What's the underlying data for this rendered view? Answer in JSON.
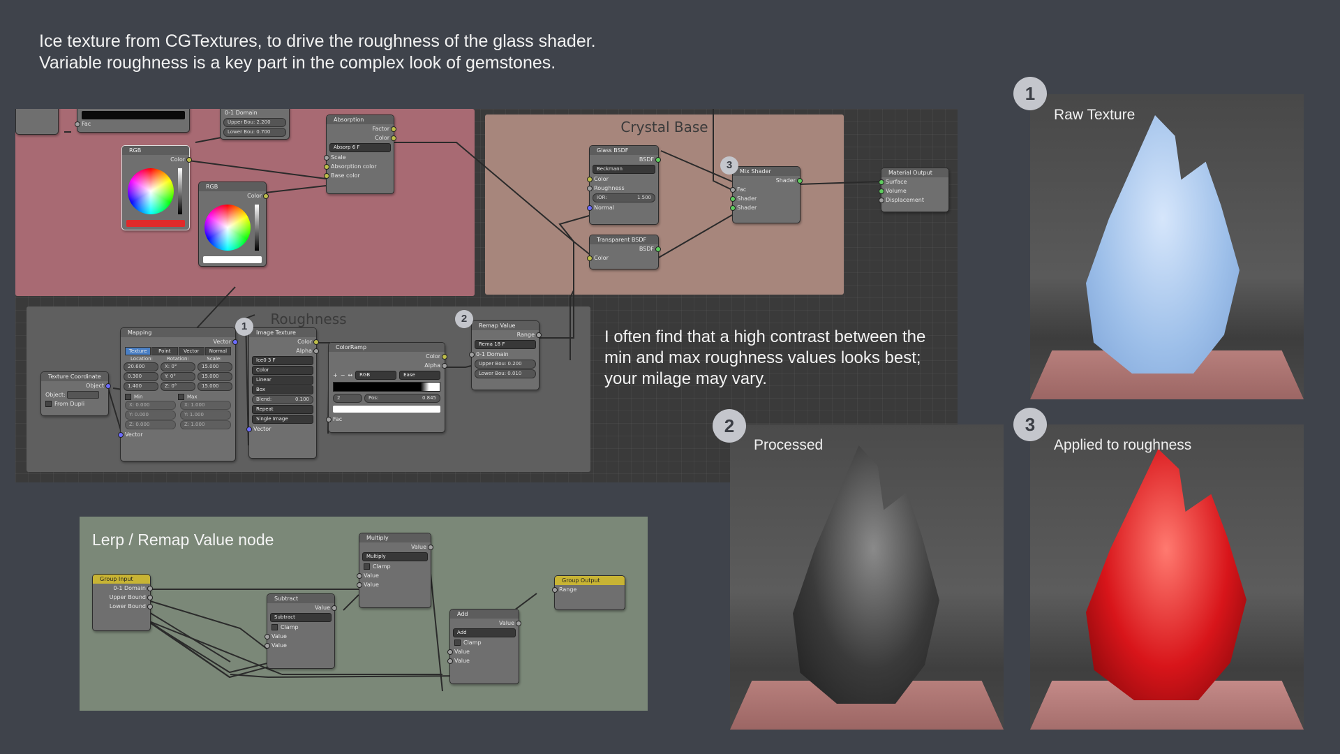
{
  "intro": {
    "line1": "Ice texture from CGTextures, to drive the roughness of the glass shader.",
    "line2": "Variable roughness is a key part in the complex look of gemstones."
  },
  "note": {
    "line1": "I often find that a high contrast between the",
    "line2": "min and max roughness values looks best;",
    "line3": "your milage may vary."
  },
  "frames": {
    "crystal_base": "Crystal Base",
    "roughness": "Roughness"
  },
  "badges": {
    "b1": "1",
    "b2": "2",
    "b3": "3"
  },
  "nodes": {
    "top_partial": {
      "socket": "Fac"
    },
    "domain_top": {
      "label": "0-1 Domain",
      "upper": "Upper Bou: 2.200",
      "lower": "Lower Bou: 0.700"
    },
    "absorption": {
      "title": "Absorption",
      "factor": "Factor",
      "color": "Color",
      "field": "Absorp",
      "field_val": "6",
      "field_f": "F",
      "scale": "Scale",
      "abs_color": "Absorption color",
      "base_color": "Base color"
    },
    "rgb1": {
      "title": "RGB",
      "color": "Color"
    },
    "rgb2": {
      "title": "RGB",
      "color": "Color"
    },
    "glass": {
      "title": "Glass BSDF",
      "bsdf": "BSDF",
      "dist": "Beckmann",
      "color": "Color",
      "roughness": "Roughness",
      "ior": "IOR:",
      "ior_val": "1.500",
      "normal": "Normal"
    },
    "transparent": {
      "title": "Transparent BSDF",
      "bsdf": "BSDF",
      "color": "Color"
    },
    "mix": {
      "title": "Mix Shader",
      "shader_out": "Shader",
      "fac": "Fac",
      "shader1": "Shader",
      "shader2": "Shader"
    },
    "output": {
      "title": "Material Output",
      "surface": "Surface",
      "volume": "Volume",
      "displacement": "Displacement"
    },
    "texcoord": {
      "title": "Texture Coordinate",
      "object_out": "Object",
      "object": "Object:",
      "from_dupli": "From Dupli"
    },
    "mapping": {
      "title": "Mapping",
      "vector_out": "Vector",
      "tabs": [
        "Texture",
        "Point",
        "Vector",
        "Normal"
      ],
      "location": "Location:",
      "rotation": "Rotation:",
      "scale": "Scale:",
      "loc": [
        "20.600",
        "0.300",
        "1.400"
      ],
      "rot": [
        "X:  0°",
        "Y:  0°",
        "Z:  0°"
      ],
      "scl": [
        "15.000",
        "15.000",
        "15.000"
      ],
      "min": "Min",
      "max": "Max",
      "minv": [
        "X: 0.000",
        "Y: 0.000",
        "Z: 0.000"
      ],
      "maxv": [
        "X: 1.000",
        "Y: 1.000",
        "Z: 1.000"
      ],
      "vector_in": "Vector"
    },
    "image": {
      "title": "Image Texture",
      "color": "Color",
      "alpha": "Alpha",
      "img": "Ice0",
      "img_n": "3",
      "img_f": "F",
      "opts": [
        "Color",
        "Linear",
        "Box"
      ],
      "blend": "Blend:",
      "blend_val": "0.100",
      "repeat": "Repeat",
      "single": "Single Image",
      "vector": "Vector"
    },
    "ramp": {
      "title": "ColorRamp",
      "color": "Color",
      "alpha": "Alpha",
      "plus": "+",
      "minus": "−",
      "flip": "↔",
      "mode": "RGB",
      "interp": "Ease",
      "index": "2",
      "pos": "Pos:",
      "pos_val": "0.845",
      "fac": "Fac"
    },
    "remap": {
      "title": "Remap Value",
      "range": "Range",
      "field": "Rema",
      "field_n": "18",
      "field_f": "F",
      "domain": "0-1 Domain",
      "upper": "Upper Bou: 0.200",
      "lower": "Lower Bou: 0.010"
    }
  },
  "lerp": {
    "title": "Lerp / Remap Value node",
    "group_input": {
      "title": "Group Input",
      "domain": "0-1 Domain",
      "upper": "Upper Bound",
      "lower": "Lower Bound"
    },
    "subtract": {
      "title": "Subtract",
      "value_out": "Value",
      "op": "Subtract",
      "clamp": "Clamp",
      "v1": "Value",
      "v2": "Value"
    },
    "multiply": {
      "title": "Multiply",
      "value_out": "Value",
      "op": "Multiply",
      "clamp": "Clamp",
      "v1": "Value",
      "v2": "Value"
    },
    "add": {
      "title": "Add",
      "value_out": "Value",
      "op": "Add",
      "clamp": "Clamp",
      "v1": "Value",
      "v2": "Value"
    },
    "group_output": {
      "title": "Group Output",
      "range": "Range"
    }
  },
  "photos": {
    "raw": {
      "num": "1",
      "label": "Raw Texture"
    },
    "processed": {
      "num": "2",
      "label": "Processed"
    },
    "applied": {
      "num": "3",
      "label": "Applied to roughness"
    }
  },
  "colors": {
    "background": "#3f434b",
    "pink_frame": "#a86a73",
    "crystal_frame": "#a7867c",
    "lerp_bg": "#7b8878"
  }
}
